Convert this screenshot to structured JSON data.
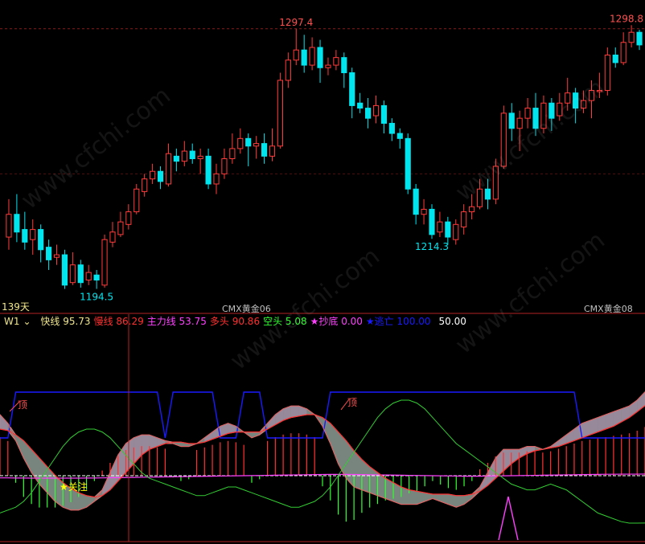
{
  "chart_data": [
    {
      "type": "candlestick",
      "title": "",
      "price_labels": {
        "high_mid": "1297.4",
        "high_right": "1298.8",
        "low_left": "1194.5",
        "low_mid": "1214.3"
      },
      "period_label": "139天",
      "contract_labels": [
        "CMX黄金06",
        "CMX黄金08"
      ],
      "ylim": [
        1188,
        1304
      ],
      "colors": {
        "up": "#ff3b3b",
        "down": "#00e5ee",
        "grid": "#8b1a1a"
      },
      "candles": [
        [
          1215,
          1224,
          1230,
          1210
        ],
        [
          1224,
          1217,
          1232,
          1213
        ],
        [
          1218,
          1213,
          1225,
          1210
        ],
        [
          1214,
          1218,
          1222,
          1208
        ],
        [
          1218,
          1210,
          1220,
          1205
        ],
        [
          1211,
          1206,
          1214,
          1202
        ],
        [
          1207,
          1208,
          1212,
          1204
        ],
        [
          1208,
          1196,
          1210,
          1194.5
        ],
        [
          1197,
          1204,
          1209,
          1196
        ],
        [
          1204,
          1197,
          1206,
          1195
        ],
        [
          1198,
          1201,
          1204,
          1196
        ],
        [
          1200,
          1198,
          1202,
          1194.5
        ],
        [
          1196,
          1214,
          1216,
          1195
        ],
        [
          1213,
          1217,
          1221,
          1211
        ],
        [
          1216,
          1221,
          1225,
          1215
        ],
        [
          1220,
          1225,
          1228,
          1218
        ],
        [
          1225,
          1234,
          1236,
          1224
        ],
        [
          1233,
          1238,
          1240,
          1231
        ],
        [
          1238,
          1241,
          1244,
          1236
        ],
        [
          1241,
          1237,
          1243,
          1234
        ],
        [
          1236,
          1248,
          1252,
          1235
        ],
        [
          1247,
          1245,
          1250,
          1241
        ],
        [
          1245,
          1249,
          1253,
          1243
        ],
        [
          1249,
          1246,
          1252,
          1244
        ],
        [
          1246,
          1247,
          1250,
          1240
        ],
        [
          1247,
          1236,
          1250,
          1234
        ],
        [
          1236,
          1240,
          1244,
          1232
        ],
        [
          1240,
          1246,
          1250,
          1238
        ],
        [
          1246,
          1250,
          1256,
          1244
        ],
        [
          1250,
          1254,
          1258,
          1248
        ],
        [
          1254,
          1251,
          1256,
          1243
        ],
        [
          1251,
          1252,
          1255,
          1246
        ],
        [
          1252,
          1247,
          1256,
          1244
        ],
        [
          1247,
          1251,
          1258,
          1245
        ],
        [
          1251,
          1277,
          1280,
          1250
        ],
        [
          1277,
          1285,
          1288,
          1274
        ],
        [
          1285,
          1289,
          1297.4,
          1283
        ],
        [
          1289,
          1283,
          1295,
          1280
        ],
        [
          1283,
          1290,
          1294,
          1281
        ],
        [
          1290,
          1282,
          1293,
          1276
        ],
        [
          1282,
          1283,
          1286,
          1279
        ],
        [
          1283,
          1286,
          1289,
          1281
        ],
        [
          1286,
          1280,
          1288,
          1274
        ],
        [
          1280,
          1267,
          1282,
          1262
        ],
        [
          1268,
          1266,
          1272,
          1264
        ],
        [
          1266,
          1262,
          1270,
          1258
        ],
        [
          1263,
          1267,
          1271,
          1260
        ],
        [
          1267,
          1260,
          1269,
          1256
        ],
        [
          1260,
          1256,
          1262,
          1253
        ],
        [
          1256,
          1254,
          1258,
          1250
        ],
        [
          1254,
          1234,
          1256,
          1232
        ],
        [
          1234,
          1224,
          1236,
          1220
        ],
        [
          1224,
          1226,
          1230,
          1220
        ],
        [
          1226,
          1216,
          1228,
          1214.3
        ],
        [
          1217,
          1221,
          1225,
          1215
        ],
        [
          1221,
          1215,
          1223,
          1212
        ],
        [
          1214,
          1220,
          1222,
          1212
        ],
        [
          1219,
          1225,
          1228,
          1216
        ],
        [
          1225,
          1227,
          1232,
          1222
        ],
        [
          1227,
          1234,
          1238,
          1226
        ],
        [
          1234,
          1230,
          1238,
          1226
        ],
        [
          1230,
          1243,
          1246,
          1228
        ],
        [
          1243,
          1264,
          1267,
          1242
        ],
        [
          1264,
          1258,
          1268,
          1253
        ],
        [
          1258,
          1262,
          1265,
          1249
        ],
        [
          1262,
          1266,
          1270,
          1258
        ],
        [
          1266,
          1258,
          1272,
          1255
        ],
        [
          1258,
          1268,
          1271,
          1256
        ],
        [
          1268,
          1262,
          1270,
          1257
        ],
        [
          1263,
          1268,
          1272,
          1261
        ],
        [
          1268,
          1272,
          1278,
          1265
        ],
        [
          1272,
          1266,
          1274,
          1260
        ],
        [
          1266,
          1269,
          1273,
          1264
        ],
        [
          1269,
          1273,
          1277,
          1262
        ],
        [
          1273,
          1273,
          1280,
          1270
        ],
        [
          1273,
          1287,
          1290,
          1271
        ],
        [
          1287,
          1284,
          1290,
          1282
        ],
        [
          1284,
          1292,
          1296,
          1283
        ],
        [
          1292,
          1296,
          1298.8,
          1290
        ],
        [
          1296,
          1291,
          1297,
          1289
        ]
      ]
    },
    {
      "type": "indicator",
      "name": "W1",
      "legend": [
        {
          "label": "快线",
          "value": "95.73",
          "color": "#f0e68c"
        },
        {
          "label": "慢线",
          "value": "86.29",
          "color": "#ff3030"
        },
        {
          "label": "主力线",
          "value": "53.75",
          "color": "#ff40ff"
        },
        {
          "label": "多头",
          "value": "90.86",
          "color": "#ff3030"
        },
        {
          "label": "空头",
          "value": "5.08",
          "color": "#33ff33"
        },
        {
          "label": "★抄底",
          "value": "0.00",
          "color": "#ff40ff"
        },
        {
          "label": "★逃亡",
          "value": "100.00",
          "color": "#1a1aff"
        },
        {
          "label": "",
          "value": "50.00",
          "color": "#ffffff"
        }
      ],
      "annotations": [
        "顶",
        "顶",
        "★关注"
      ],
      "ylim": [
        0,
        100
      ],
      "fast": [
        80,
        74,
        62,
        50,
        40,
        32,
        26,
        20,
        16,
        14,
        14,
        16,
        20,
        28,
        40,
        52,
        60,
        64,
        66,
        66,
        64,
        62,
        60,
        58,
        58,
        60,
        64,
        68,
        72,
        74,
        72,
        68,
        64,
        66,
        74,
        80,
        84,
        86,
        86,
        84,
        80,
        72,
        60,
        46,
        36,
        30,
        28,
        26,
        24,
        22,
        20,
        18,
        18,
        18,
        20,
        22,
        20,
        18,
        16,
        18,
        22,
        30,
        40,
        50,
        56,
        56,
        56,
        58,
        58,
        56,
        58,
        62,
        66,
        70,
        74,
        76,
        78,
        80,
        82,
        84,
        86,
        90,
        95.73
      ],
      "slow": [
        70,
        69,
        66,
        62,
        56,
        50,
        44,
        38,
        33,
        29,
        26,
        24,
        23,
        24,
        28,
        34,
        40,
        46,
        52,
        56,
        58,
        60,
        61,
        61,
        60,
        60,
        61,
        63,
        65,
        67,
        68,
        68,
        68,
        68,
        70,
        73,
        76,
        78,
        79,
        80,
        80,
        78,
        74,
        68,
        62,
        55,
        49,
        44,
        40,
        36,
        33,
        30,
        28,
        27,
        26,
        25,
        25,
        25,
        24,
        24,
        25,
        27,
        31,
        36,
        41,
        46,
        50,
        53,
        55,
        56,
        57,
        58,
        60,
        62,
        64,
        66,
        68,
        70,
        72,
        75,
        78,
        82,
        86.29
      ],
      "main": [
        22,
        22,
        21,
        21,
        20,
        20,
        20,
        20,
        20,
        20,
        20,
        21,
        21,
        22,
        23,
        24,
        25,
        26,
        27,
        28,
        29,
        30,
        31,
        32,
        33,
        34,
        35,
        36,
        37,
        38,
        39,
        40,
        41,
        42,
        43,
        44,
        45,
        46,
        47,
        48,
        49,
        50,
        51,
        51,
        51,
        50,
        49,
        48,
        47,
        46,
        45,
        44,
        43,
        42,
        41,
        40,
        39,
        38,
        37,
        36,
        36,
        36,
        37,
        38,
        39,
        40,
        41,
        42,
        43,
        44,
        45,
        46,
        47,
        48,
        49,
        50,
        51,
        52,
        52,
        53,
        53,
        53,
        53.75
      ],
      "bear": [
        12,
        14,
        16,
        20,
        26,
        34,
        42,
        50,
        58,
        64,
        68,
        70,
        70,
        68,
        64,
        58,
        52,
        46,
        40,
        36,
        34,
        32,
        30,
        28,
        26,
        24,
        24,
        26,
        28,
        30,
        30,
        28,
        26,
        24,
        22,
        20,
        18,
        16,
        16,
        18,
        20,
        24,
        30,
        38,
        46,
        54,
        62,
        70,
        78,
        84,
        88,
        90,
        90,
        88,
        84,
        78,
        72,
        66,
        60,
        56,
        52,
        48,
        44,
        40,
        36,
        32,
        30,
        28,
        28,
        30,
        32,
        30,
        28,
        24,
        20,
        16,
        12,
        10,
        8,
        6,
        5,
        5,
        5.08
      ]
    }
  ]
}
